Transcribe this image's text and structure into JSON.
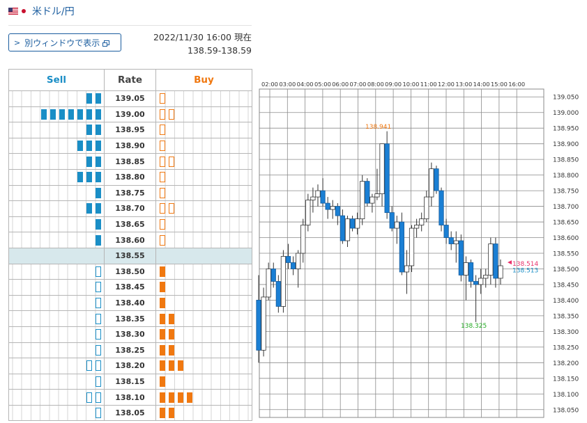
{
  "header": {
    "pair": "米ドル/円",
    "flag_left": "us-flag-icon",
    "flag_right": "jp-flag-icon"
  },
  "window_button": {
    "label": "別ウィンドウで表示",
    "chevron": "chevron-right-icon",
    "ext_icon": "external-window-icon"
  },
  "timestamp": {
    "datetime": "2022/11/30 16:00 現在",
    "range": "138.59-138.59"
  },
  "table": {
    "col_sell": "Sell",
    "col_rate": "Rate",
    "col_buy": "Buy",
    "colors": {
      "sell": "#1a8ec6",
      "buy": "#f07810",
      "mid_row": "#d7e8ec"
    },
    "rows": [
      {
        "rate": "139.05",
        "sell": [
          1,
          1
        ],
        "buy": [
          0
        ]
      },
      {
        "rate": "139.00",
        "sell": [
          1,
          1,
          1,
          1,
          1,
          1,
          1
        ],
        "buy": [
          0,
          0
        ]
      },
      {
        "rate": "138.95",
        "sell": [
          1,
          1
        ],
        "buy": [
          0
        ]
      },
      {
        "rate": "138.90",
        "sell": [
          1,
          1,
          1
        ],
        "buy": [
          0
        ]
      },
      {
        "rate": "138.85",
        "sell": [
          1,
          1
        ],
        "buy": [
          0,
          0
        ]
      },
      {
        "rate": "138.80",
        "sell": [
          1,
          1,
          1
        ],
        "buy": [
          0
        ]
      },
      {
        "rate": "138.75",
        "sell": [
          1
        ],
        "buy": [
          0
        ]
      },
      {
        "rate": "138.70",
        "sell": [
          1,
          1
        ],
        "buy": [
          0,
          0
        ]
      },
      {
        "rate": "138.65",
        "sell": [
          1
        ],
        "buy": [
          0
        ]
      },
      {
        "rate": "138.60",
        "sell": [
          1
        ],
        "buy": [
          0
        ]
      },
      {
        "rate": "138.55",
        "sell": [],
        "buy": [],
        "mid": true
      },
      {
        "rate": "138.50",
        "sell": [
          0
        ],
        "buy": [
          1
        ]
      },
      {
        "rate": "138.45",
        "sell": [
          0
        ],
        "buy": [
          1
        ]
      },
      {
        "rate": "138.40",
        "sell": [
          0
        ],
        "buy": [
          1
        ]
      },
      {
        "rate": "138.35",
        "sell": [
          0
        ],
        "buy": [
          1,
          1
        ]
      },
      {
        "rate": "138.30",
        "sell": [
          0
        ],
        "buy": [
          1,
          1
        ]
      },
      {
        "rate": "138.25",
        "sell": [
          0
        ],
        "buy": [
          1,
          1
        ]
      },
      {
        "rate": "138.20",
        "sell": [
          0,
          0
        ],
        "buy": [
          1,
          1,
          1
        ]
      },
      {
        "rate": "138.15",
        "sell": [
          0
        ],
        "buy": [
          1
        ]
      },
      {
        "rate": "138.10",
        "sell": [
          0,
          0
        ],
        "buy": [
          1,
          1,
          1,
          1
        ]
      },
      {
        "rate": "138.05",
        "sell": [
          0
        ],
        "buy": [
          1,
          1
        ]
      }
    ]
  },
  "chart_data": {
    "type": "candlestick",
    "x_ticks": [
      "02:00",
      "03:00",
      "04:00",
      "05:00",
      "06:00",
      "07:00",
      "08:00",
      "09:00",
      "10:00",
      "11:00",
      "12:00",
      "13:00",
      "14:00",
      "15:00",
      "16:00"
    ],
    "y_ticks": [
      "139.050",
      "139.000",
      "138.950",
      "138.900",
      "138.850",
      "138.800",
      "138.750",
      "138.700",
      "138.650",
      "138.600",
      "138.550",
      "138.500",
      "138.450",
      "138.400",
      "138.350",
      "138.300",
      "138.250",
      "138.200",
      "138.150",
      "138.100",
      "138.050"
    ],
    "ylim": [
      138.025,
      139.075
    ],
    "grid": true,
    "annotations": [
      {
        "text": "138.941",
        "kind": "high",
        "color": "#f07810"
      },
      {
        "text": "138.325",
        "kind": "low",
        "color": "#22aa22"
      },
      {
        "text": "138.514",
        "kind": "ask",
        "color": "#e8306a"
      },
      {
        "text": "138.513",
        "kind": "bid",
        "color": "#1a8ec6"
      }
    ],
    "colors": {
      "up": "#ffffff",
      "down": "#1a7fd4",
      "wick": "#333333"
    },
    "candles": [
      [
        138.4,
        138.48,
        138.2,
        138.24
      ],
      [
        138.24,
        138.44,
        138.22,
        138.41
      ],
      [
        138.41,
        138.52,
        138.4,
        138.5
      ],
      [
        138.5,
        138.52,
        138.44,
        138.46
      ],
      [
        138.46,
        138.48,
        138.36,
        138.38
      ],
      [
        138.38,
        138.56,
        138.36,
        138.54
      ],
      [
        138.54,
        138.58,
        138.5,
        138.52
      ],
      [
        138.52,
        138.54,
        138.48,
        138.5
      ],
      [
        138.5,
        138.56,
        138.44,
        138.55
      ],
      [
        138.55,
        138.66,
        138.52,
        138.64
      ],
      [
        138.64,
        138.74,
        138.62,
        138.72
      ],
      [
        138.72,
        138.76,
        138.68,
        138.73
      ],
      [
        138.73,
        138.77,
        138.7,
        138.75
      ],
      [
        138.75,
        138.79,
        138.7,
        138.71
      ],
      [
        138.71,
        138.73,
        138.66,
        138.69
      ],
      [
        138.69,
        138.72,
        138.66,
        138.7
      ],
      [
        138.7,
        138.71,
        138.64,
        138.67
      ],
      [
        138.67,
        138.69,
        138.58,
        138.59
      ],
      [
        138.59,
        138.67,
        138.57,
        138.66
      ],
      [
        138.66,
        138.67,
        138.62,
        138.63
      ],
      [
        138.63,
        138.68,
        138.61,
        138.66
      ],
      [
        138.66,
        138.8,
        138.64,
        138.78
      ],
      [
        138.78,
        138.79,
        138.7,
        138.71
      ],
      [
        138.71,
        138.74,
        138.68,
        138.73
      ],
      [
        138.73,
        138.82,
        138.72,
        138.74
      ],
      [
        138.74,
        138.9,
        138.7,
        138.9
      ],
      [
        138.9,
        138.94,
        138.66,
        138.68
      ],
      [
        138.68,
        138.7,
        138.62,
        138.63
      ],
      [
        138.63,
        138.67,
        138.58,
        138.65
      ],
      [
        138.65,
        138.68,
        138.48,
        138.49
      ],
      [
        138.49,
        138.56,
        138.42,
        138.51
      ],
      [
        138.51,
        138.64,
        138.49,
        138.63
      ],
      [
        138.63,
        138.66,
        138.6,
        138.64
      ],
      [
        138.64,
        138.68,
        138.62,
        138.66
      ],
      [
        138.66,
        138.75,
        138.65,
        138.73
      ],
      [
        138.73,
        138.84,
        138.7,
        138.82
      ],
      [
        138.82,
        138.83,
        138.74,
        138.75
      ],
      [
        138.75,
        138.76,
        138.62,
        138.64
      ],
      [
        138.64,
        138.66,
        138.58,
        138.6
      ],
      [
        138.6,
        138.62,
        138.56,
        138.58
      ],
      [
        138.58,
        138.62,
        138.52,
        138.59
      ],
      [
        138.59,
        138.61,
        138.46,
        138.48
      ],
      [
        138.48,
        138.54,
        138.4,
        138.52
      ],
      [
        138.52,
        138.53,
        138.44,
        138.46
      ],
      [
        138.46,
        138.48,
        138.33,
        138.45
      ],
      [
        138.45,
        138.5,
        138.42,
        138.47
      ],
      [
        138.47,
        138.5,
        138.44,
        138.48
      ],
      [
        138.48,
        138.6,
        138.45,
        138.58
      ],
      [
        138.58,
        138.6,
        138.44,
        138.47
      ],
      [
        138.47,
        138.53,
        138.45,
        138.51
      ]
    ]
  }
}
